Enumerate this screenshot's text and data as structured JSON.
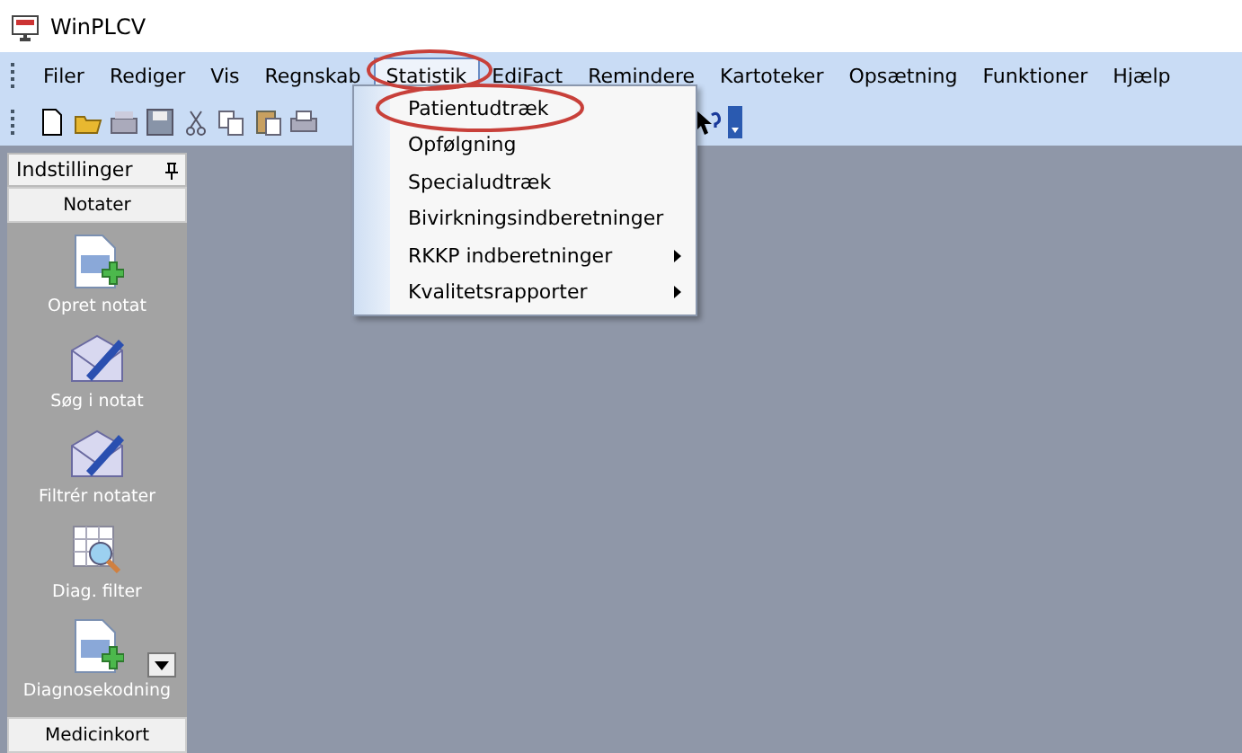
{
  "window": {
    "title": "WinPLCV"
  },
  "menu": [
    {
      "label": "Filer",
      "selected": false
    },
    {
      "label": "Rediger",
      "selected": false
    },
    {
      "label": "Vis",
      "selected": false
    },
    {
      "label": "Regnskab",
      "selected": false
    },
    {
      "label": "Statistik",
      "selected": true
    },
    {
      "label": "EdiFact",
      "selected": false
    },
    {
      "label": "Remindere",
      "selected": false
    },
    {
      "label": "Kartoteker",
      "selected": false
    },
    {
      "label": "Opsætning",
      "selected": false
    },
    {
      "label": "Funktioner",
      "selected": false
    },
    {
      "label": "Hjælp",
      "selected": false
    }
  ],
  "dropdown": [
    {
      "label": "Patientudtræk",
      "submenu": false
    },
    {
      "label": "Opfølgning",
      "submenu": false
    },
    {
      "label": "Specialudtræk",
      "submenu": false
    },
    {
      "label": "Bivirkningsindberetninger",
      "submenu": false
    },
    {
      "label": "RKKP indberetninger",
      "submenu": true
    },
    {
      "label": "Kvalitetsrapporter",
      "submenu": true
    }
  ],
  "sidebar": {
    "title": "Indstillinger",
    "section": "Notater",
    "footer": "Medicinkort",
    "items": [
      {
        "label": "Opret notat",
        "kind": "newdoc"
      },
      {
        "label": "Søg i notat",
        "kind": "mail"
      },
      {
        "label": "Filtrér notater",
        "kind": "mail"
      },
      {
        "label": "Diag. filter",
        "kind": "grid"
      },
      {
        "label": "Diagnosekodning",
        "kind": "newdoc"
      }
    ]
  }
}
